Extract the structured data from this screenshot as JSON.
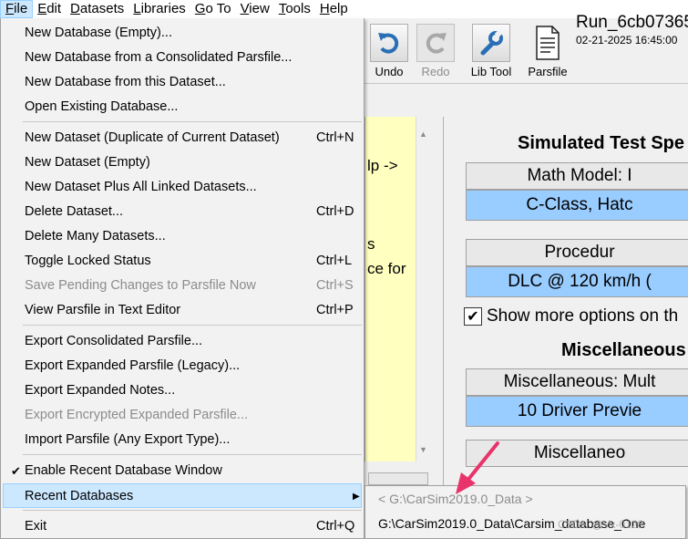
{
  "menubar": [
    {
      "key": "F",
      "rest": "ile",
      "active": true
    },
    {
      "key": "E",
      "rest": "dit",
      "active": false
    },
    {
      "key": "D",
      "rest": "atasets",
      "active": false
    },
    {
      "key": "L",
      "rest": "ibraries",
      "active": false
    },
    {
      "key": "G",
      "rest": "o To",
      "active": false
    },
    {
      "key": "V",
      "rest": "iew",
      "active": false
    },
    {
      "key": "T",
      "rest": "ools",
      "active": false
    },
    {
      "key": "H",
      "rest": "elp",
      "active": false
    }
  ],
  "toolbar": {
    "undo": {
      "label": "Undo",
      "icon": "undo-icon"
    },
    "redo": {
      "label": "Redo",
      "icon": "redo-icon"
    },
    "libtool": {
      "label": "Lib Tool",
      "icon": "wrench-icon"
    },
    "parsfile": {
      "label": "Parsfile",
      "icon": "document-icon"
    },
    "run_name": "Run_6cb07365",
    "run_date": "02-21-2025 16:45:00"
  },
  "file_menu": {
    "new_db_empty": "New Database (Empty)...",
    "new_db_consolidated": "New Database from a Consolidated Parsfile...",
    "new_db_dataset": "New Database from this Dataset...",
    "open_existing": "Open Existing Database...",
    "new_dataset_dup": "New Dataset (Duplicate of Current Dataset)",
    "new_dataset_dup_sc": "Ctrl+N",
    "new_dataset_empty": "New Dataset (Empty)",
    "new_dataset_linked": "New Dataset Plus All Linked Datasets...",
    "delete_dataset": "Delete Dataset...",
    "delete_dataset_sc": "Ctrl+D",
    "delete_many": "Delete Many Datasets...",
    "toggle_locked": "Toggle Locked Status",
    "toggle_locked_sc": "Ctrl+L",
    "save_pending": "Save Pending Changes to Parsfile Now",
    "save_pending_sc": "Ctrl+S",
    "view_parsfile": "View Parsfile in Text Editor",
    "view_parsfile_sc": "Ctrl+P",
    "export_consolidated": "Export Consolidated Parsfile...",
    "export_expanded": "Export Expanded Parsfile (Legacy)...",
    "export_notes": "Export Expanded Notes...",
    "export_encrypted": "Export Encrypted Expanded Parsfile...",
    "import_parsfile": "Import Parsfile (Any Export Type)...",
    "enable_recent": "Enable Recent Database Window",
    "recent_databases": "Recent Databases",
    "exit": "Exit",
    "exit_sc": "Ctrl+Q"
  },
  "submenu": {
    "header": "< G:\\CarSim2019.0_Data >",
    "item1": "G:\\CarSim2019.0_Data\\Carsim_database_One"
  },
  "left_panel": {
    "line1": "lp ->",
    "line2": "s",
    "line3": "ce for"
  },
  "right_panel": {
    "heading1": "Simulated Test Spe",
    "math_model_label": "Math Model: I",
    "math_model_value": "C-Class, Hatc",
    "procedure_label": "Procedur",
    "procedure_value": "DLC @ 120 km/h (",
    "show_more": "Show more options on th",
    "heading2": "Miscellaneous",
    "misc_label": "Miscellaneous: Mult",
    "misc_value": "10 Driver Previe",
    "misc_label2": "Miscellaneo"
  },
  "watermark": "CSDN @Vx-0128",
  "colors": {
    "highlight": "#cce8ff",
    "link_blue": "#99ccff",
    "help_yellow": "#ffffc0",
    "arrow": "#e8336b"
  }
}
